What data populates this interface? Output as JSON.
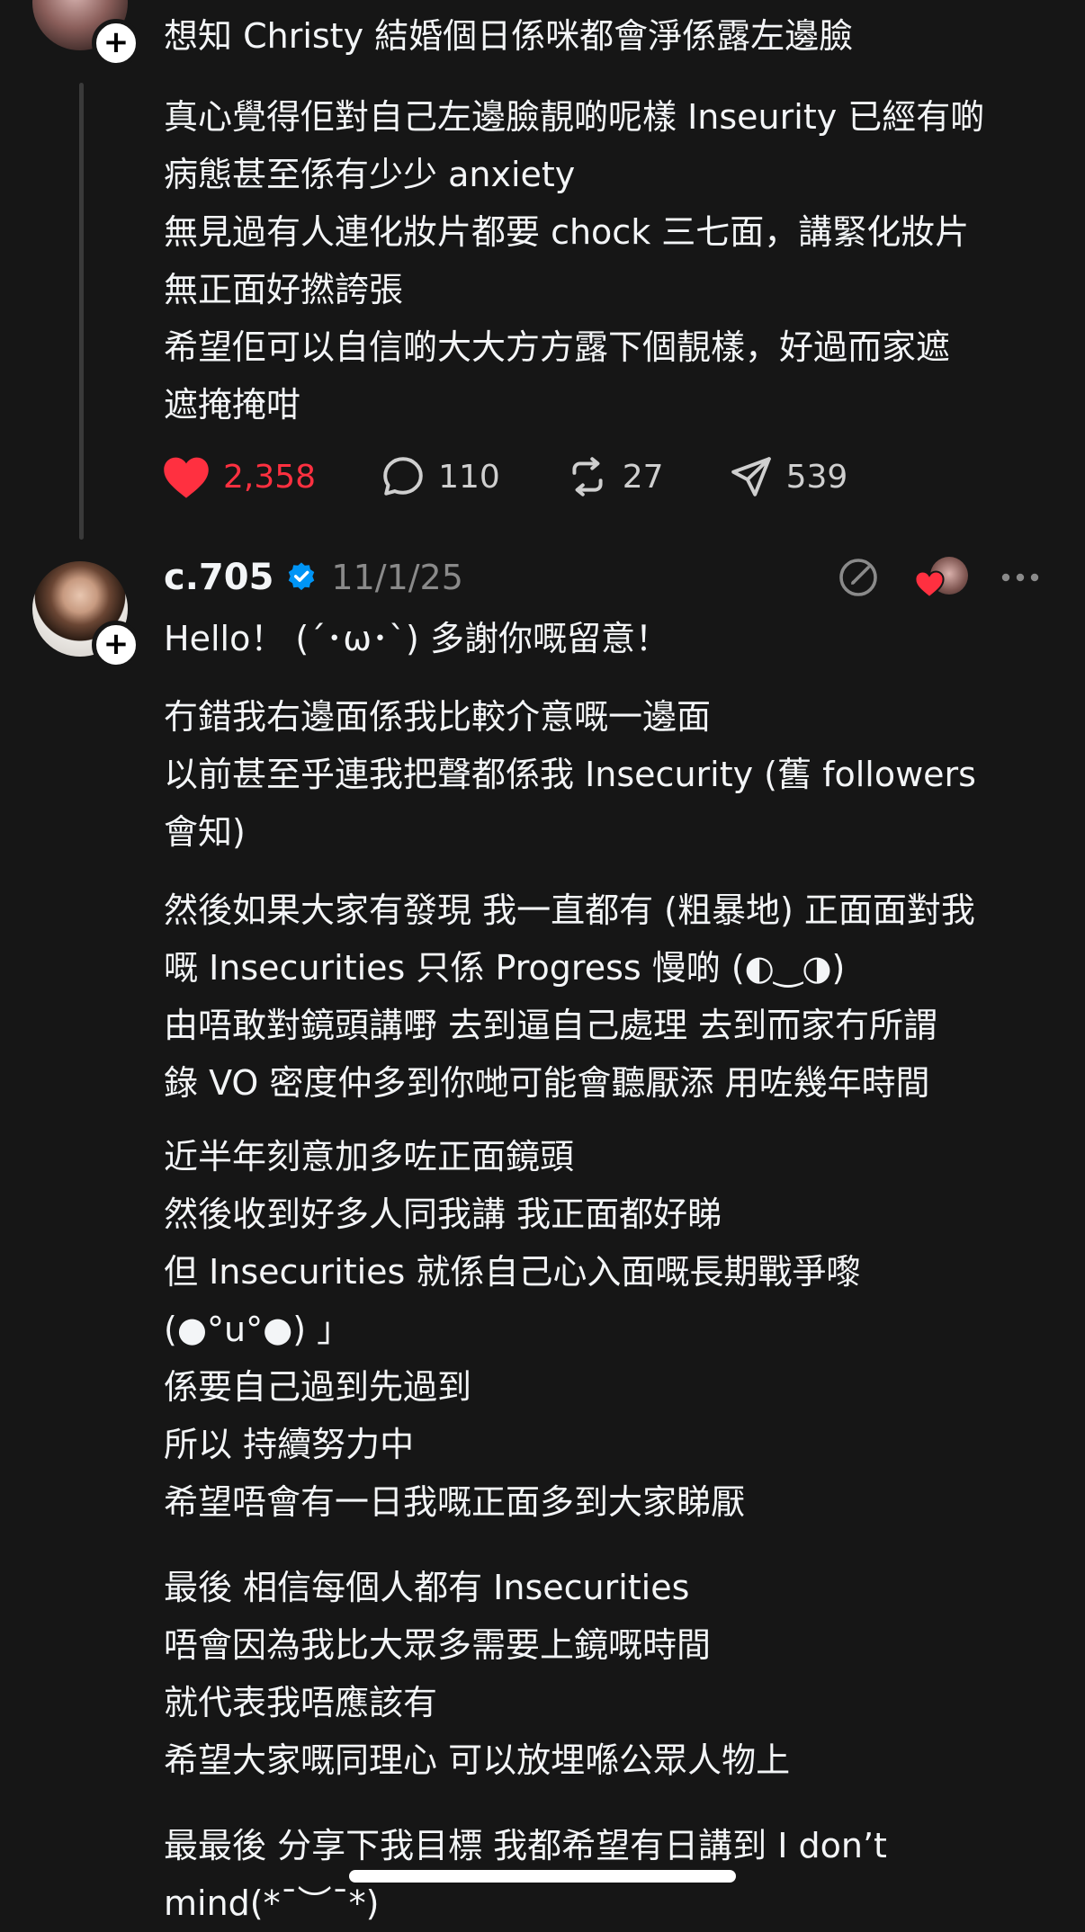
{
  "parent_post": {
    "text_top": "想知 Christy 結婚個日係咪都會淨係露左邊臉",
    "body_lines": [
      "真心覺得佢對自己左邊臉靚啲呢樣 Inseurity 已經有啲\n病態甚至係有少少 anxiety",
      "無見過有人連化妝片都要 chock 三七面，講緊化妝片\n無正面好撚誇張",
      "希望佢可以自信啲大大方方露下個靚樣，好過而家遮\n遮掩掩咁"
    ],
    "likes": "2,358",
    "replies": "110",
    "reposts": "27",
    "shares": "539"
  },
  "reply": {
    "username": "c.705",
    "date": "11/1/25",
    "paragraphs": [
      "Hello！ (´･ω･`) 多謝你嘅留意！",
      "冇錯我右邊面係我比較介意嘅一邊面\n以前甚至乎連我把聲都係我 Insecurity (舊 followers\n會知)",
      "然後如果大家有發現 我一直都有 (粗暴地) 正面面對我\n嘅 Insecurities 只係 Progress 慢啲 (◐‿◑)\n由唔敢對鏡頭講嘢 去到逼自己處理 去到而家冇所謂\n錄 VO 密度仲多到你哋可能會聽厭添 用咗幾年時間",
      "近半年刻意加多咗正面鏡頭\n然後收到好多人同我講 我正面都好睇\n但 Insecurities 就係自己心入面嘅長期戰爭嚟\n(●°u°●) 」\n係要自己過到先過到\n所以 持續努力中\n希望唔會有一日我嘅正面多到大家睇厭",
      "最後 相信每個人都有 Insecurities\n唔會因為我比大眾多需要上鏡嘅時間\n就代表我唔應該有\n希望大家嘅同理心 可以放埋喺公眾人物上",
      "最最後 分享下我目標 我都希望有日講到 I don’t\nmind(*¯︶¯*)"
    ]
  },
  "icons": {
    "heart": "heart-filled-icon",
    "reply": "comment-bubble-icon",
    "repost": "repost-icon",
    "share": "send-icon",
    "verified": "verified-badge-icon",
    "edit": "edit-circle-icon",
    "more": "more-dots-icon"
  },
  "colors": {
    "background": "#161616",
    "text": "#f3f5f7",
    "like_red": "#ff3040",
    "verified_blue": "#0095f6",
    "muted": "#8a8a8a"
  }
}
